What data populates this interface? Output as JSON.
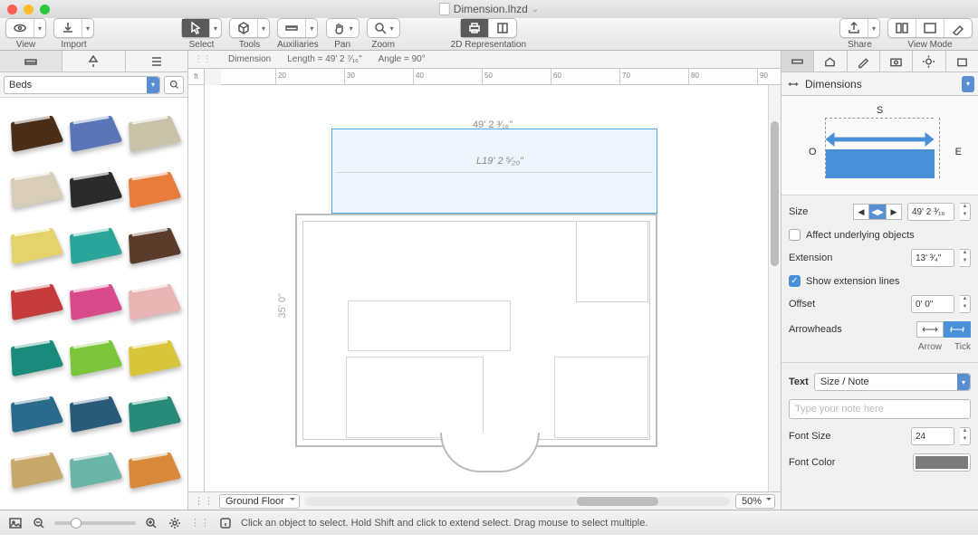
{
  "window": {
    "title": "Dimension.lhzd"
  },
  "toolbar": {
    "view": "View",
    "import": "Import",
    "select": "Select",
    "tools": "Tools",
    "auxiliaries": "Auxiliaries",
    "pan": "Pan",
    "zoom": "Zoom",
    "rep2d": "2D Representation",
    "share": "Share",
    "viewmode": "View Mode"
  },
  "library": {
    "category": "Beds"
  },
  "canvas": {
    "infobar": {
      "label": "Dimension",
      "length": "Length = 49' 2 ⁷⁄₁₆\"",
      "angle": "Angle = 90°"
    },
    "ruler_unit": "ft",
    "ruler_ticks": [
      "20",
      "30",
      "40",
      "50",
      "60",
      "70",
      "80",
      "90"
    ],
    "dim_top": "49' 2 ³⁄₁₆\"",
    "dim_mid": "L19' 2 ⁵⁄₂₀\"",
    "dim_v": "35' 0\"",
    "room_note": "",
    "floor": "Ground Floor",
    "zoom": "50%"
  },
  "inspector": {
    "title": "Dimensions",
    "diagram": {
      "s": "S",
      "o": "O",
      "e": "E"
    },
    "size_label": "Size",
    "size_value": "49' 2 ³⁄₁₆",
    "affect": "Affect underlying objects",
    "extension_label": "Extension",
    "extension_value": "13' ³⁄₄\"",
    "show_ext": "Show extension lines",
    "offset_label": "Offset",
    "offset_value": "0' 0\"",
    "arrowheads_label": "Arrowheads",
    "arrow": "Arrow",
    "tick": "Tick",
    "text_label": "Text",
    "text_mode": "Size / Note",
    "note_placeholder": "Type your note here",
    "font_size_label": "Font Size",
    "font_size_value": "24",
    "font_color_label": "Font Color"
  },
  "statusbar": {
    "hint": "Click an object to select. Hold Shift and click to extend select. Drag mouse to select multiple."
  },
  "bed_colors": [
    "#4a2e18",
    "#5a76b8",
    "#c8c2a8",
    "#d8cdb8",
    "#2a2a2a",
    "#e87c3a",
    "#e4d36a",
    "#2aa59a",
    "#5a3a2a",
    "#c53a3a",
    "#d84a8a",
    "#e8b4b4",
    "#1a8a7a",
    "#7ac53a",
    "#d8c53a",
    "#2a6a8a",
    "#2a5a7a",
    "#2a8a7a",
    "#c8a86a",
    "#6ab4a8",
    "#d88a3a"
  ]
}
